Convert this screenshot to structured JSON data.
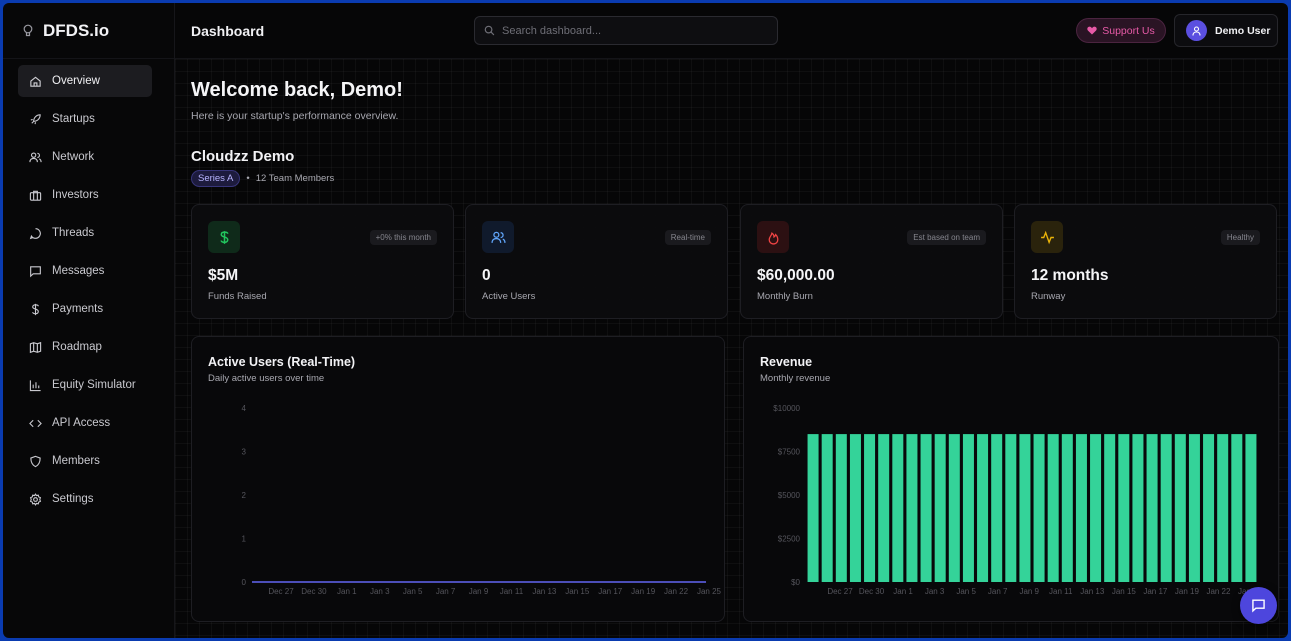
{
  "brand": {
    "name": "DFDS.io",
    "icon": "lightbulb-icon"
  },
  "topbar": {
    "title": "Dashboard",
    "search_placeholder": "Search dashboard...",
    "support_label": "Support Us",
    "user_name": "Demo User"
  },
  "sidebar": {
    "items": [
      {
        "label": "Overview",
        "icon": "home-icon",
        "active": true
      },
      {
        "label": "Startups",
        "icon": "rocket-icon"
      },
      {
        "label": "Network",
        "icon": "users-icon"
      },
      {
        "label": "Investors",
        "icon": "briefcase-icon"
      },
      {
        "label": "Threads",
        "icon": "chat-bubble-icon"
      },
      {
        "label": "Messages",
        "icon": "message-square-icon"
      },
      {
        "label": "Payments",
        "icon": "dollar-icon"
      },
      {
        "label": "Roadmap",
        "icon": "map-icon"
      },
      {
        "label": "Equity Simulator",
        "icon": "bar-chart-icon"
      },
      {
        "label": "API Access",
        "icon": "code-icon"
      },
      {
        "label": "Members",
        "icon": "shield-icon"
      },
      {
        "label": "Settings",
        "icon": "gear-icon"
      }
    ]
  },
  "main": {
    "welcome": "Welcome back, Demo!",
    "subtitle": "Here is your startup's performance overview.",
    "company": "Cloudzz Demo",
    "series": "Series A",
    "team": "12 Team Members",
    "separator": "•"
  },
  "cards": [
    {
      "value": "$5M",
      "label": "Funds Raised",
      "tag": "+0% this month",
      "icon": "dollar-icon",
      "accent": "#22c55e"
    },
    {
      "value": "0",
      "label": "Active Users",
      "tag": "Real-time",
      "icon": "users-icon",
      "accent": "#60a5fa"
    },
    {
      "value": "$60,000.00",
      "label": "Monthly Burn",
      "tag": "Est based on team",
      "icon": "flame-icon",
      "accent": "#ef4444"
    },
    {
      "value": "12 months",
      "label": "Runway",
      "tag": "Healthy",
      "icon": "activity-icon",
      "accent": "#eab308"
    }
  ],
  "chart_data": [
    {
      "type": "line",
      "title": "Active Users (Real-Time)",
      "subtitle": "Daily active users over time",
      "x_tick_labels": [
        "Dec 27",
        "Dec 30",
        "Jan 1",
        "Jan 3",
        "Jan 5",
        "Jan 7",
        "Jan 9",
        "Jan 11",
        "Jan 13",
        "Jan 15",
        "Jan 17",
        "Jan 19",
        "Jan 22",
        "Jan 25"
      ],
      "y_ticks": [
        0,
        1,
        2,
        3,
        4
      ],
      "ylim": [
        0,
        4
      ],
      "values": [
        0,
        0,
        0,
        0,
        0,
        0,
        0,
        0,
        0,
        0,
        0,
        0,
        0,
        0
      ],
      "color": "#6366f1"
    },
    {
      "type": "bar",
      "title": "Revenue",
      "subtitle": "Monthly revenue",
      "x_tick_labels": [
        "Dec 27",
        "Dec 30",
        "Jan 1",
        "Jan 3",
        "Jan 5",
        "Jan 7",
        "Jan 9",
        "Jan 11",
        "Jan 13",
        "Jan 15",
        "Jan 17",
        "Jan 19",
        "Jan 22",
        "Jan 25"
      ],
      "y_ticks": [
        "$0",
        "$2500",
        "$5000",
        "$7500",
        "$10000"
      ],
      "y_tick_values": [
        0,
        2500,
        5000,
        7500,
        10000
      ],
      "ylim": [
        0,
        10000
      ],
      "bar_count": 32,
      "values": [
        8500,
        8500,
        8500,
        8500,
        8500,
        8500,
        8500,
        8500,
        8500,
        8500,
        8500,
        8500,
        8500,
        8500,
        8500,
        8500,
        8500,
        8500,
        8500,
        8500,
        8500,
        8500,
        8500,
        8500,
        8500,
        8500,
        8500,
        8500,
        8500,
        8500,
        8500,
        8500
      ],
      "color": "#34d399"
    }
  ],
  "fab": {
    "icon": "chat-icon"
  }
}
